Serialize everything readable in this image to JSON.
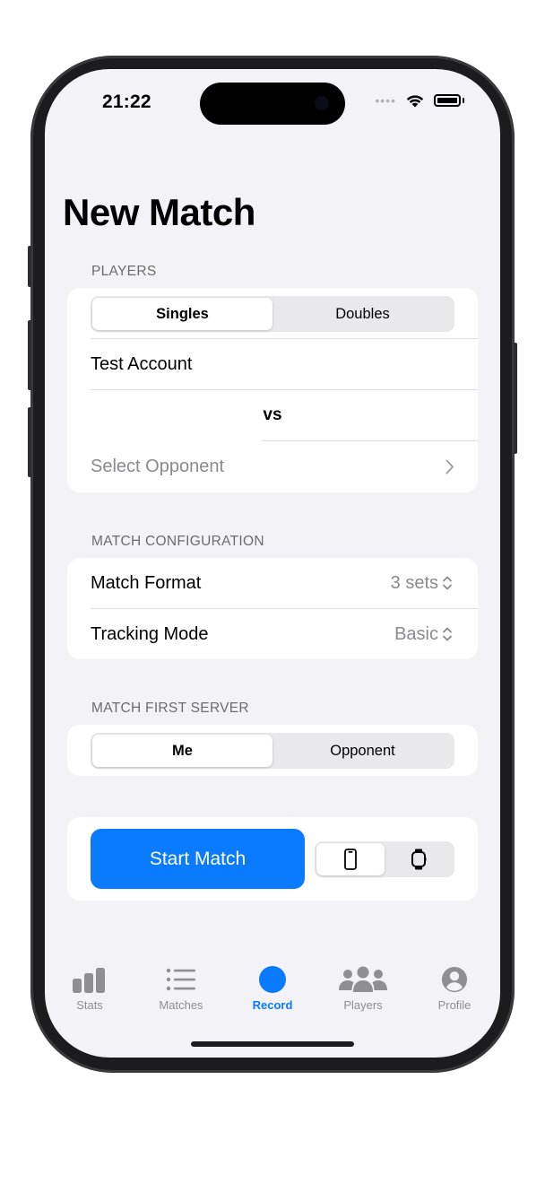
{
  "status_bar": {
    "time": "21:22",
    "signal_dots": "••••"
  },
  "page": {
    "title": "New Match"
  },
  "players": {
    "header": "PLAYERS",
    "mode_options": [
      "Singles",
      "Doubles"
    ],
    "selected_mode": "Singles",
    "player_one": "Test Account",
    "versus": "vs",
    "opponent_placeholder": "Select Opponent"
  },
  "configuration": {
    "header": "MATCH CONFIGURATION",
    "match_format_label": "Match Format",
    "match_format_value": "3 sets",
    "tracking_mode_label": "Tracking Mode",
    "tracking_mode_value": "Basic"
  },
  "first_server": {
    "header": "MATCH FIRST SERVER",
    "options": [
      "Me",
      "Opponent"
    ],
    "selected": "Me"
  },
  "actions": {
    "start_label": "Start Match",
    "device_options": [
      "phone-icon",
      "watch-icon"
    ],
    "selected_device": "phone-icon"
  },
  "tab_bar": {
    "items": [
      {
        "label": "Stats",
        "icon": "bar-chart-icon"
      },
      {
        "label": "Matches",
        "icon": "list-icon"
      },
      {
        "label": "Record",
        "icon": "record-icon"
      },
      {
        "label": "Players",
        "icon": "people-icon"
      },
      {
        "label": "Profile",
        "icon": "person-circle-icon"
      }
    ],
    "active": "Record"
  },
  "colors": {
    "accent": "#0a7aff",
    "background": "#f2f2f7",
    "secondary_text": "#8a8a8e"
  }
}
